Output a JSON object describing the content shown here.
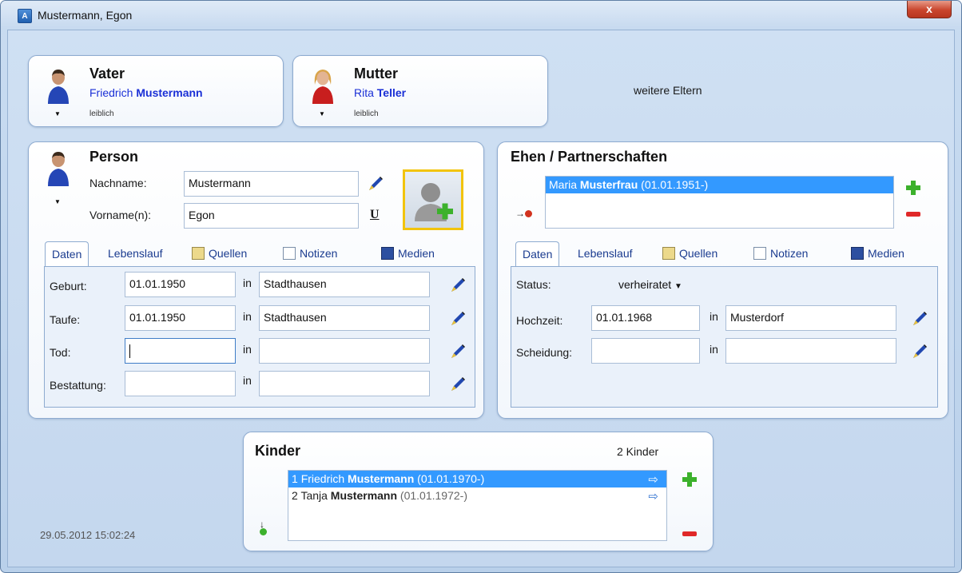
{
  "window": {
    "title": "Mustermann, Egon",
    "close_label": "x",
    "app_icon_label": "A"
  },
  "father": {
    "role": "Vater",
    "first_name": "Friedrich",
    "last_name": "Mustermann",
    "relation": "leiblich"
  },
  "mother": {
    "role": "Mutter",
    "first_name": "Rita",
    "last_name": "Teller",
    "relation": "leiblich"
  },
  "more_parents": {
    "label": "weitere Eltern"
  },
  "person": {
    "title": "Person",
    "surname_label": "Nachname:",
    "surname_value": "Mustermann",
    "given_label": "Vorname(n):",
    "given_value": "Egon",
    "underline_btn": "U",
    "tabs": [
      "Daten",
      "Lebenslauf",
      "Quellen",
      "Notizen",
      "Medien"
    ],
    "events": [
      {
        "label": "Geburt:",
        "date": "01.01.1950",
        "in": "in",
        "place": "Stadthausen"
      },
      {
        "label": "Taufe:",
        "date": "01.01.1950",
        "in": "in",
        "place": "Stadthausen"
      },
      {
        "label": "Tod:",
        "date": "",
        "in": "in",
        "place": ""
      },
      {
        "label": "Bestattung:",
        "date": "",
        "in": "in",
        "place": ""
      }
    ]
  },
  "marriages": {
    "title": "Ehen / Partnerschaften",
    "items": [
      {
        "first": "Maria",
        "last": "Musterfrau",
        "dates": "(01.01.1951-)"
      }
    ],
    "tabs": [
      "Daten",
      "Lebenslauf",
      "Quellen",
      "Notizen",
      "Medien"
    ],
    "status_label": "Status:",
    "status_value": "verheiratet",
    "wedding_label": "Hochzeit:",
    "wedding_date": "01.01.1968",
    "wedding_in": "in",
    "wedding_place": "Musterdorf",
    "divorce_label": "Scheidung:",
    "divorce_date": "",
    "divorce_in": "in",
    "divorce_place": ""
  },
  "children": {
    "title": "Kinder",
    "count": "2 Kinder",
    "items": [
      {
        "num": "1",
        "first": "Friedrich",
        "last": "Mustermann",
        "dates": "(01.01.1970-)"
      },
      {
        "num": "2",
        "first": "Tanja",
        "last": "Mustermann",
        "dates": "(01.01.1972-)"
      }
    ]
  },
  "footer": {
    "timestamp": "29.05.2012 15:02:24"
  },
  "colors": {
    "accent": "#3399ff",
    "link": "#1a2fd6",
    "add": "#3cb12c",
    "remove": "#e02828"
  }
}
